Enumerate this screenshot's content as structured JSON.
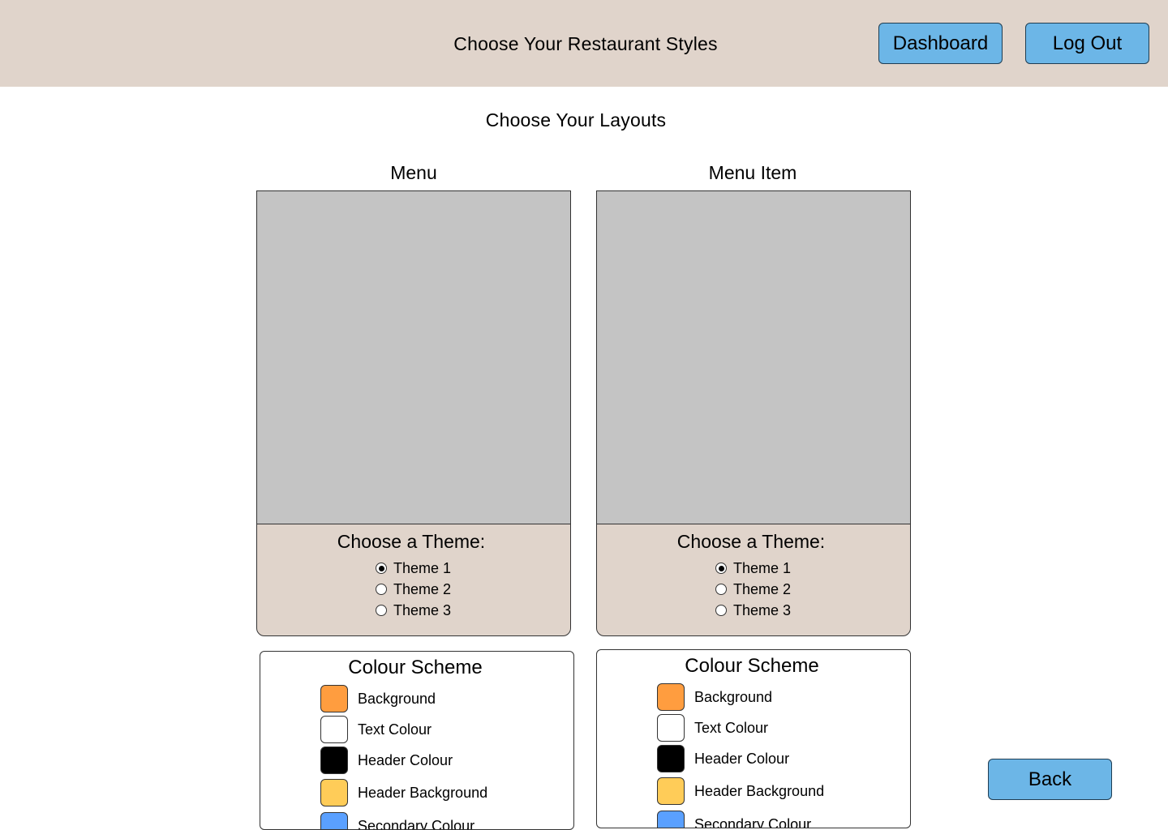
{
  "header": {
    "title": "Choose Your Restaurant Styles",
    "dashboard_label": "Dashboard",
    "logout_label": "Log Out",
    "background": "#e0d4cb"
  },
  "main": {
    "title": "Choose Your Layouts",
    "back_label": "Back"
  },
  "layouts": [
    {
      "title": "Menu",
      "theme_heading": "Choose a Theme:",
      "themes": [
        "Theme 1",
        "Theme 2",
        "Theme 3"
      ],
      "selected_theme": "Theme 1",
      "colour_scheme": {
        "title": "Colour Scheme",
        "items": [
          {
            "label": "Background",
            "color": "#ff9d3f"
          },
          {
            "label": "Text Colour",
            "color": "#ffffff"
          },
          {
            "label": "Header Colour",
            "color": "#000000"
          },
          {
            "label": "Header Background",
            "color": "#ffcc58"
          },
          {
            "label": "Secondary Colour",
            "color": "#5aa0ff"
          }
        ]
      }
    },
    {
      "title": "Menu Item",
      "theme_heading": "Choose a Theme:",
      "themes": [
        "Theme 1",
        "Theme 2",
        "Theme 3"
      ],
      "selected_theme": "Theme 1",
      "colour_scheme": {
        "title": "Colour Scheme",
        "items": [
          {
            "label": "Background",
            "color": "#ff9d3f"
          },
          {
            "label": "Text Colour",
            "color": "#ffffff"
          },
          {
            "label": "Header Colour",
            "color": "#000000"
          },
          {
            "label": "Header Background",
            "color": "#ffcc58"
          },
          {
            "label": "Secondary Colour",
            "color": "#5aa0ff"
          }
        ]
      }
    }
  ],
  "colors": {
    "button": "#6cb6e7",
    "preview": "#c4c4c4",
    "panel": "#e0d4cb"
  }
}
